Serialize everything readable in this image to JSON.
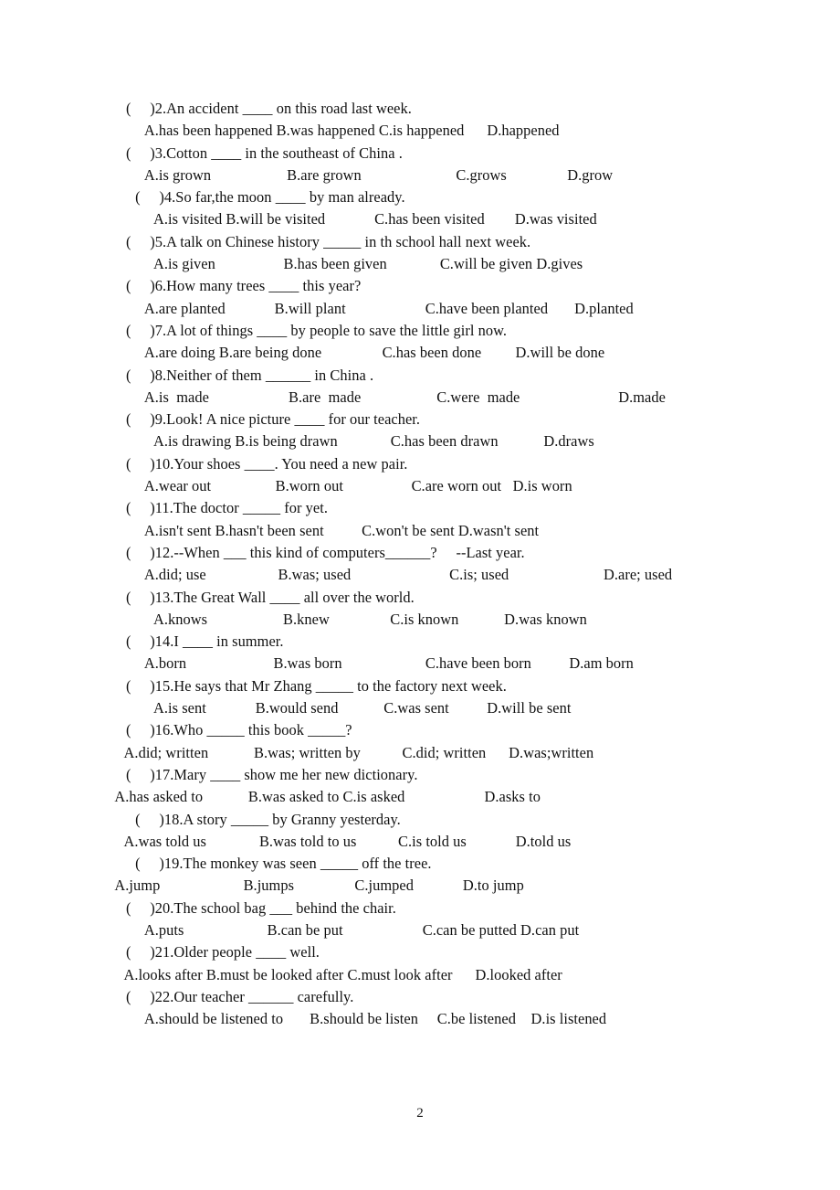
{
  "document": {
    "page_number": "2",
    "exercise_type": "multiple-choice-grammar-passive-voice",
    "questions": [
      {
        "marker": "(",
        "close": ")",
        "number": "2.",
        "stem": "An accident ____ on this road last week.",
        "question_text": "(     )2.An accident ____ on this road last week.",
        "options_text": "     A.has been happened B.was happened C.is happened      D.happened",
        "options": [
          "A.has been happened",
          "B.was happened",
          "C.is happened",
          "D.happened"
        ],
        "q_indent": 6,
        "o_indent": 34
      },
      {
        "marker": "(",
        "close": ")",
        "number": "3.",
        "stem": "Cotton ____ in the southeast of China .",
        "question_text": "(     )3.Cotton ____ in the southeast of China .",
        "options_text": "     A.is grown                    B.are grown                         C.grows                D.grow",
        "options": [
          "A.is grown",
          "B.are grown",
          "C.grows",
          "D.grow"
        ],
        "q_indent": 6,
        "o_indent": 34
      },
      {
        "marker": "(",
        "close": ")",
        "number": "4.",
        "stem": "So far,the moon ____ by man already.",
        "question_text": " (     )4.So far,the moon ____ by man already.",
        "options_text": "      A.is visited B.will be visited             C.has been visited        D.was visited",
        "options": [
          "A.is visited",
          "B.will be visited",
          "C.has been visited",
          "D.was visited"
        ],
        "q_indent": 12,
        "o_indent": 40
      },
      {
        "marker": "(",
        "close": ")",
        "number": "5.",
        "stem": "A talk on Chinese history _____ in th school hall next week.",
        "question_text": "(     )5.A talk on Chinese history _____ in th school hall next week.",
        "options_text": "      A.is given                  B.has been given              C.will be given D.gives",
        "options": [
          "A.is given",
          "B.has been given",
          "C.will be given",
          "D.gives"
        ],
        "q_indent": 6,
        "o_indent": 40
      },
      {
        "marker": "(",
        "close": ")",
        "number": "6.",
        "stem": "How many trees ____ this year?",
        "question_text": "(     )6.How many trees ____ this year?",
        "options_text": "     A.are planted             B.will plant                     C.have been planted       D.planted",
        "options": [
          "A.are planted",
          "B.will plant",
          "C.have been planted",
          "D.planted"
        ],
        "q_indent": 6,
        "o_indent": 34
      },
      {
        "marker": "(",
        "close": ")",
        "number": "7.",
        "stem": "A lot of things ____ by people to save the little girl now.",
        "question_text": "(     )7.A lot of things ____ by people to save the little girl now.",
        "options_text": "     A.are doing B.are being done                C.has been done         D.will be done",
        "options": [
          "A.are doing",
          "B.are being done",
          "C.has been done",
          "D.will be done"
        ],
        "q_indent": 6,
        "o_indent": 34
      },
      {
        "marker": "(",
        "close": ")",
        "number": "8.",
        "stem": "Neither of them ______ in China .",
        "question_text": "(     )8.Neither of them ______ in China .",
        "options_text": "     A.is  made                     B.are  made                    C.were  made                          D.made",
        "options": [
          "A.is  made",
          "B.are  made",
          "C.were  made",
          "D.made"
        ],
        "q_indent": 6,
        "o_indent": 34
      },
      {
        "marker": "(",
        "close": ")",
        "number": "9.",
        "stem": "Look! A nice picture ____ for our teacher.",
        "question_text": "(     )9.Look! A nice picture ____ for our teacher.",
        "options_text": "      A.is drawing B.is being drawn              C.has been drawn            D.draws",
        "options": [
          "A.is drawing",
          "B.is being drawn",
          "C.has been drawn",
          "D.draws"
        ],
        "q_indent": 6,
        "o_indent": 40
      },
      {
        "marker": "(",
        "close": ")",
        "number": "10.",
        "stem": "Your shoes ____. You need a new pair.",
        "question_text": "(     )10.Your shoes ____. You need a new pair.",
        "options_text": "     A.wear out                 B.worn out                  C.are worn out   D.is worn",
        "options": [
          "A.wear out",
          "B.worn out",
          "C.are worn out",
          "D.is worn"
        ],
        "q_indent": 6,
        "o_indent": 34
      },
      {
        "marker": "(",
        "close": ")",
        "number": "11.",
        "stem": "The doctor _____ for yet.",
        "question_text": "(     )11.The doctor _____ for yet.",
        "options_text": "     A.isn't sent B.hasn't been sent          C.won't be sent D.wasn't sent",
        "options": [
          "A.isn't sent",
          "B.hasn't been sent",
          "C.won't be sent",
          "D.wasn't sent"
        ],
        "q_indent": 6,
        "o_indent": 34
      },
      {
        "marker": "(",
        "close": ")",
        "number": "12.",
        "stem": "--When ___ this kind of computers______?     --Last year.",
        "question_text": "(     )12.--When ___ this kind of computers______?     --Last year.",
        "options_text": "     A.did; use                   B.was; used                          C.is; used                         D.are; used",
        "options": [
          "A.did; use",
          "B.was; used",
          "C.is; used",
          "D.are; used"
        ],
        "q_indent": 6,
        "o_indent": 34
      },
      {
        "marker": "(",
        "close": ")",
        "number": "13.",
        "stem": "The Great Wall ____ all over the world.",
        "question_text": "(     )13.The Great Wall ____ all over the world.",
        "options_text": "      A.knows                    B.knew                C.is known            D.was known",
        "options": [
          "A.knows",
          "B.knew",
          "C.is known",
          "D.was known"
        ],
        "q_indent": 6,
        "o_indent": 40
      },
      {
        "marker": "(",
        "close": ")",
        "number": "14.",
        "stem": "I ____ in summer.",
        "question_text": "(     )14.I ____ in summer.",
        "options_text": "     A.born                       B.was born                      C.have been born          D.am born",
        "options": [
          "A.born",
          "B.was born",
          "C.have been born",
          "D.am born"
        ],
        "q_indent": 6,
        "o_indent": 34
      },
      {
        "marker": "(",
        "close": ")",
        "number": "15.",
        "stem": "He says that Mr Zhang _____ to the factory next week.",
        "question_text": "(     )15.He says that Mr Zhang _____ to the factory next week.",
        "options_text": "      A.is sent             B.would send            C.was sent          D.will be sent",
        "options": [
          "A.is sent",
          "B.would send",
          "C.was sent",
          "D.will be sent"
        ],
        "q_indent": 6,
        "o_indent": 40
      },
      {
        "marker": "(",
        "close": ")",
        "number": "16.",
        "stem": "Who _____ this book _____?",
        "question_text": "(     )16.Who _____ this book _____?",
        "options_text": "   A.did; written            B.was; written by           C.did; written      D.was;written",
        "options": [
          "A.did; written",
          "B.was; written by",
          "C.did; written",
          "D.was;written"
        ],
        "q_indent": 6,
        "o_indent": 20
      },
      {
        "marker": "(",
        "close": ")",
        "number": "17.",
        "stem": "Mary ____ show me her new dictionary.",
        "question_text": "(     )17.Mary ____ show me her new dictionary.",
        "options_text": "  A.has asked to            B.was asked to C.is asked                     D.asks to",
        "options": [
          "A.has asked to",
          "B.was asked to",
          "C.is asked",
          "D.asks to"
        ],
        "q_indent": 6,
        "o_indent": 14
      },
      {
        "marker": "(",
        "close": ")",
        "number": "18.",
        "stem": "A story _____ by Granny yesterday.",
        "question_text": " (     )18.A story _____ by Granny yesterday.",
        "options_text": "   A.was told us              B.was told to us           C.is told us             D.told us",
        "options": [
          "A.was told us",
          "B.was told to us",
          "C.is told us",
          "D.told us"
        ],
        "q_indent": 12,
        "o_indent": 20
      },
      {
        "marker": "(",
        "close": ")",
        "number": "19.",
        "stem": "The monkey was seen _____ off the tree.",
        "question_text": " (     )19.The monkey was seen _____ off the tree.",
        "options_text": "  A.jump                      B.jumps                C.jumped             D.to jump",
        "options": [
          "A.jump",
          "B.jumps",
          "C.jumped",
          "D.to jump"
        ],
        "q_indent": 12,
        "o_indent": 14
      },
      {
        "marker": "(",
        "close": ")",
        "number": "20.",
        "stem": "The school bag ___ behind the chair.",
        "question_text": "(     )20.The school bag ___ behind the chair.",
        "options_text": "     A.puts                      B.can be put                     C.can be putted D.can put",
        "options": [
          "A.puts",
          "B.can be put",
          "C.can be putted",
          "D.can put"
        ],
        "q_indent": 6,
        "o_indent": 34
      },
      {
        "marker": "(",
        "close": ")",
        "number": "21.",
        "stem": "Older people ____ well.",
        "question_text": "(     )21.Older people ____ well.",
        "options_text": "   A.looks after B.must be looked after C.must look after      D.looked after",
        "options": [
          "A.looks after",
          "B.must be looked after",
          "C.must look after",
          "D.looked after"
        ],
        "q_indent": 6,
        "o_indent": 20
      },
      {
        "marker": "(",
        "close": ")",
        "number": "22.",
        "stem": "Our teacher ______ carefully.",
        "question_text": "(     )22.Our teacher ______ carefully.",
        "options_text": "     A.should be listened to       B.should be listen     C.be listened    D.is listened",
        "options": [
          "A.should be listened to",
          "B.should be listen",
          "C.be listened",
          "D.is listened"
        ],
        "q_indent": 6,
        "o_indent": 34
      }
    ]
  }
}
